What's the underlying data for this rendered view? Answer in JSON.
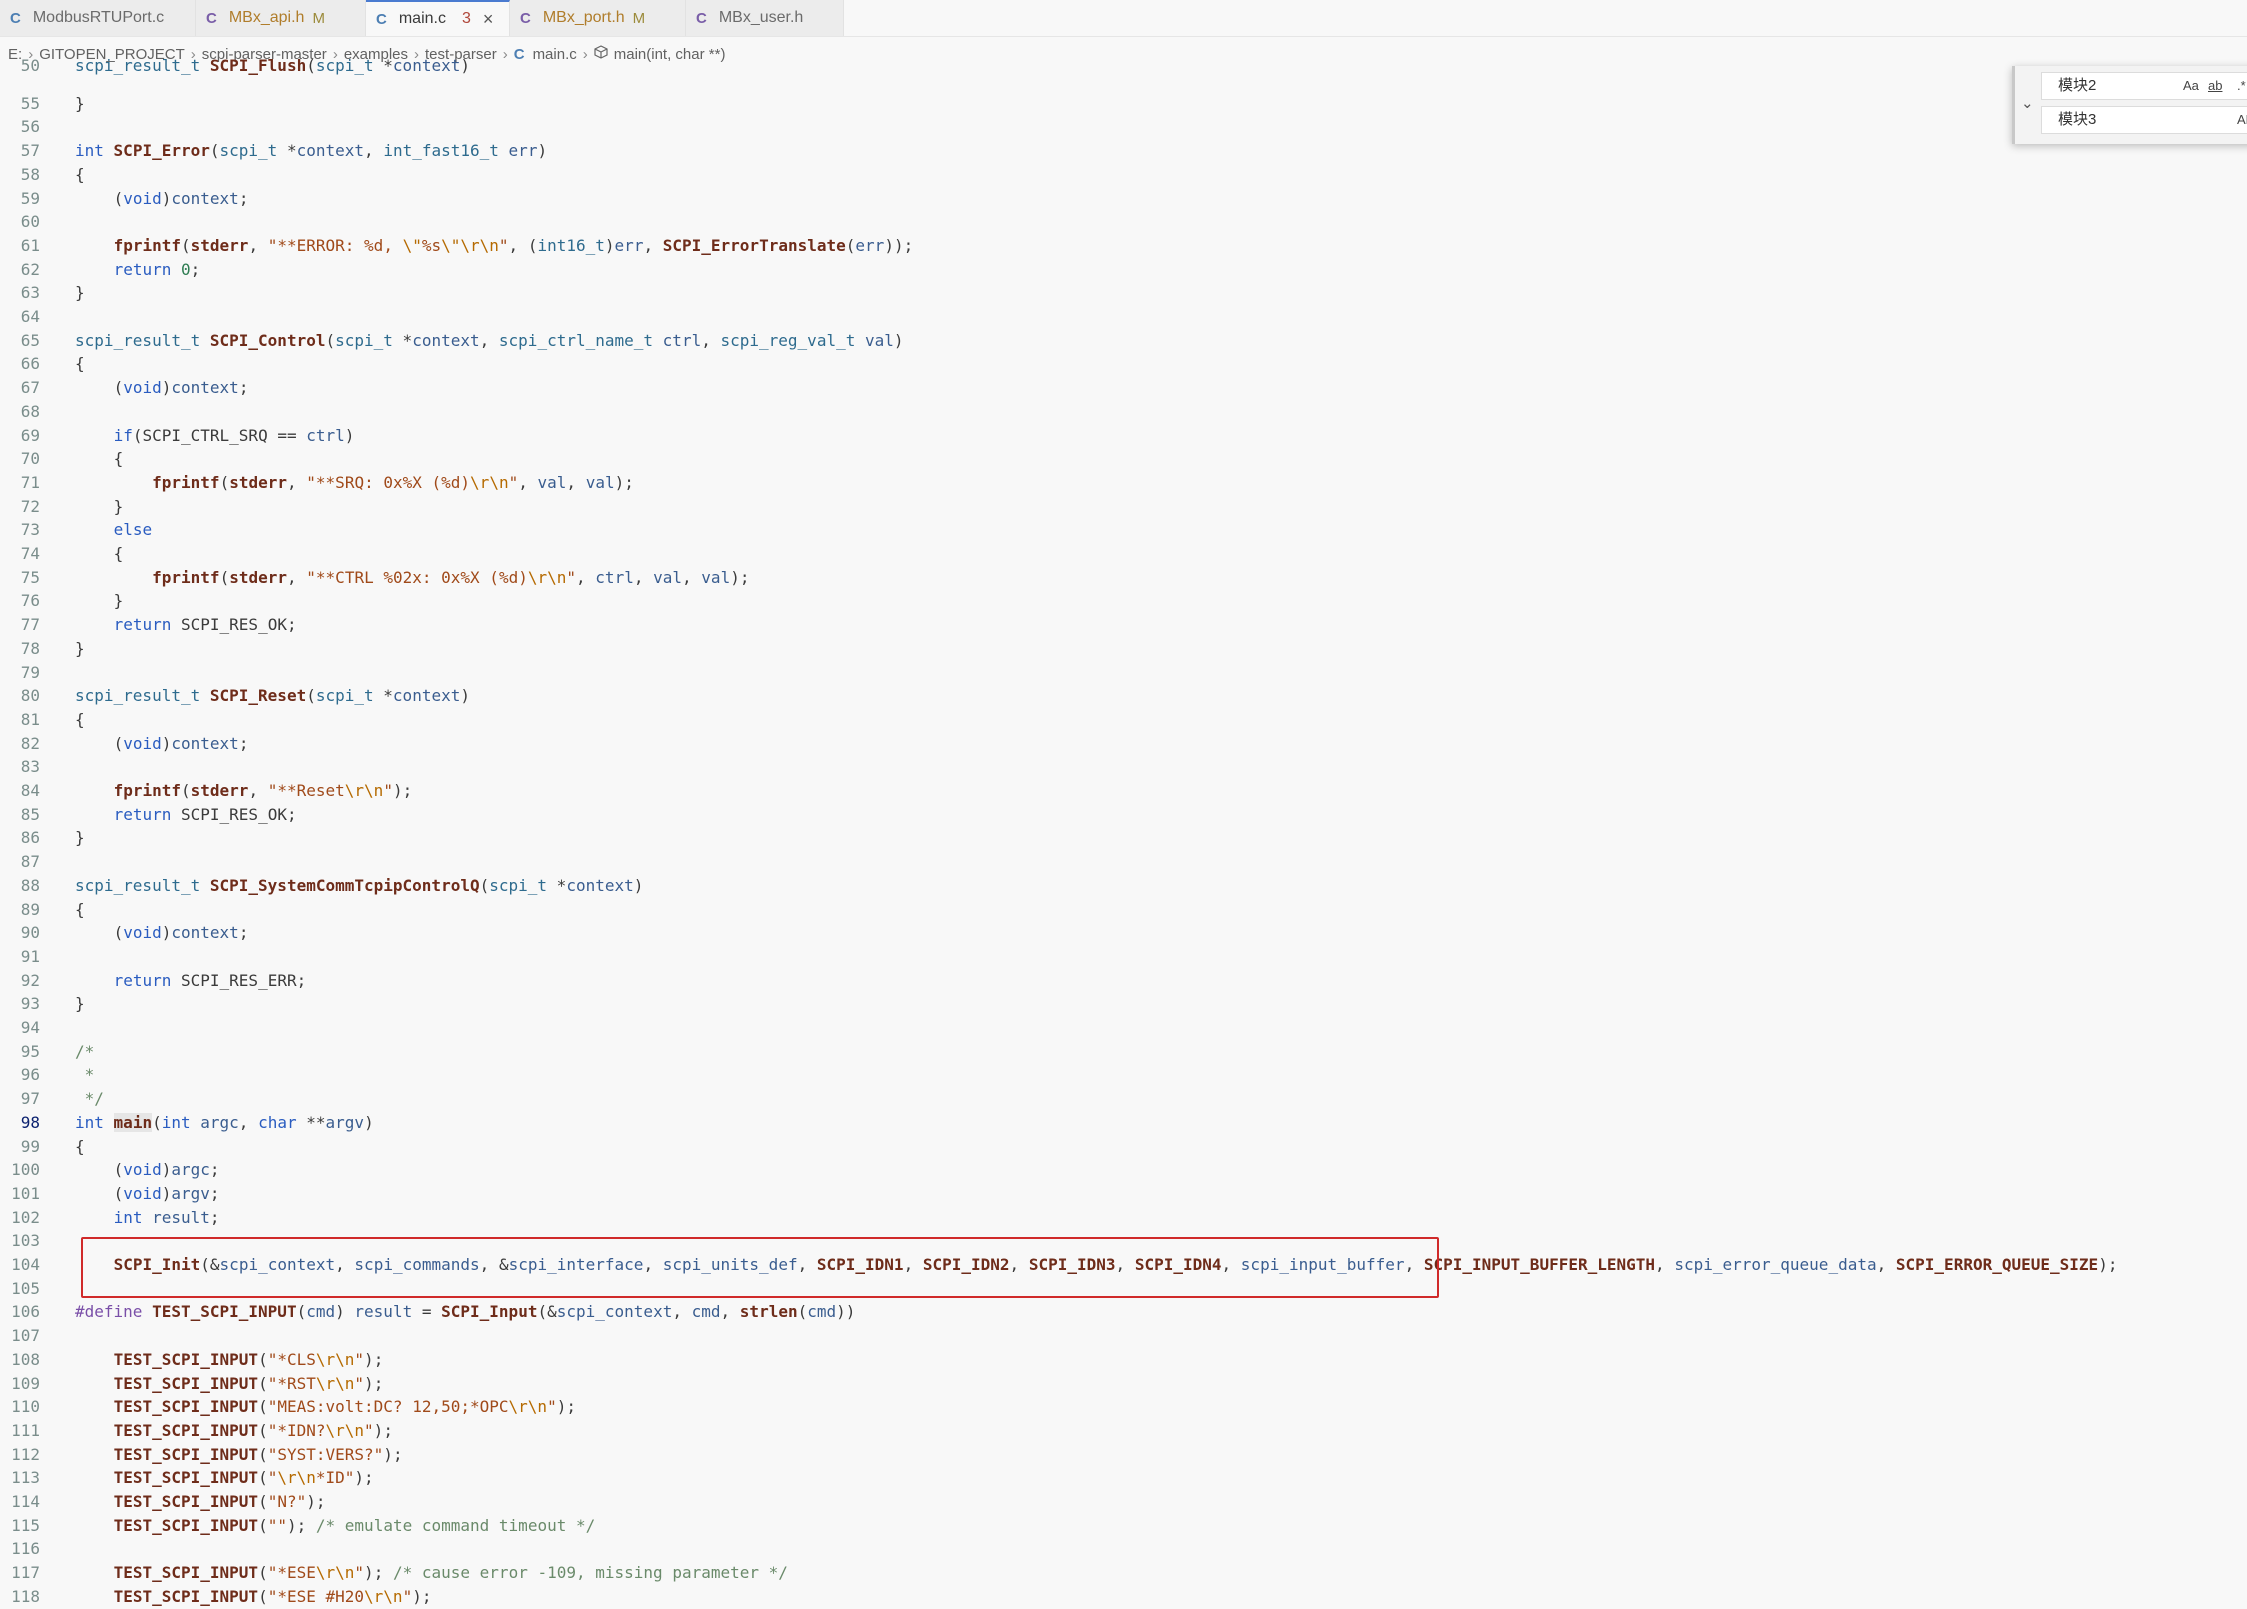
{
  "tabs": [
    {
      "label": "ModbusRTUPort.c",
      "icon": "C",
      "modified": "",
      "problems": ""
    },
    {
      "label": "MBx_api.h",
      "icon": "C",
      "modified": "M",
      "problems": ""
    },
    {
      "label": "main.c",
      "icon": "C",
      "modified": "",
      "problems": "3"
    },
    {
      "label": "MBx_port.h",
      "icon": "C",
      "modified": "M",
      "problems": ""
    },
    {
      "label": "MBx_user.h",
      "icon": "C",
      "modified": "",
      "problems": ""
    }
  ],
  "breadcrumb": [
    "E:",
    "GITOPEN_PROJECT",
    "scpi-parser-master",
    "examples",
    "test-parser",
    "main.c",
    "main(int, char **)"
  ],
  "find_widget": {
    "find_value": "模块2",
    "replace_value": "模块3",
    "match_case": "Aa",
    "whole_word": "ab",
    "regex": ".*",
    "replace_all": "AB"
  },
  "current_line": "98",
  "code_lines": [
    {
      "n": "50",
      "text": "scpi_result_t SCPI_Flush(scpi_t *context)"
    },
    {
      "n": "55",
      "text": "}"
    },
    {
      "n": "56",
      "text": ""
    },
    {
      "n": "57",
      "text": "int SCPI_Error(scpi_t *context, int_fast16_t err)"
    },
    {
      "n": "58",
      "text": "{"
    },
    {
      "n": "59",
      "text": "    (void)context;"
    },
    {
      "n": "60",
      "text": ""
    },
    {
      "n": "61",
      "text": "    fprintf(stderr, \"**ERROR: %d, \\\"%s\\\"\\r\\n\", (int16_t)err, SCPI_ErrorTranslate(err));"
    },
    {
      "n": "62",
      "text": "    return 0;"
    },
    {
      "n": "63",
      "text": "}"
    },
    {
      "n": "64",
      "text": ""
    },
    {
      "n": "65",
      "text": "scpi_result_t SCPI_Control(scpi_t *context, scpi_ctrl_name_t ctrl, scpi_reg_val_t val)"
    },
    {
      "n": "66",
      "text": "{"
    },
    {
      "n": "67",
      "text": "    (void)context;"
    },
    {
      "n": "68",
      "text": ""
    },
    {
      "n": "69",
      "text": "    if(SCPI_CTRL_SRQ == ctrl)"
    },
    {
      "n": "70",
      "text": "    {"
    },
    {
      "n": "71",
      "text": "        fprintf(stderr, \"**SRQ: 0x%X (%d)\\r\\n\", val, val);"
    },
    {
      "n": "72",
      "text": "    }"
    },
    {
      "n": "73",
      "text": "    else"
    },
    {
      "n": "74",
      "text": "    {"
    },
    {
      "n": "75",
      "text": "        fprintf(stderr, \"**CTRL %02x: 0x%X (%d)\\r\\n\", ctrl, val, val);"
    },
    {
      "n": "76",
      "text": "    }"
    },
    {
      "n": "77",
      "text": "    return SCPI_RES_OK;"
    },
    {
      "n": "78",
      "text": "}"
    },
    {
      "n": "79",
      "text": ""
    },
    {
      "n": "80",
      "text": "scpi_result_t SCPI_Reset(scpi_t *context)"
    },
    {
      "n": "81",
      "text": "{"
    },
    {
      "n": "82",
      "text": "    (void)context;"
    },
    {
      "n": "83",
      "text": ""
    },
    {
      "n": "84",
      "text": "    fprintf(stderr, \"**Reset\\r\\n\");"
    },
    {
      "n": "85",
      "text": "    return SCPI_RES_OK;"
    },
    {
      "n": "86",
      "text": "}"
    },
    {
      "n": "87",
      "text": ""
    },
    {
      "n": "88",
      "text": "scpi_result_t SCPI_SystemCommTcpipControlQ(scpi_t *context)"
    },
    {
      "n": "89",
      "text": "{"
    },
    {
      "n": "90",
      "text": "    (void)context;"
    },
    {
      "n": "91",
      "text": ""
    },
    {
      "n": "92",
      "text": "    return SCPI_RES_ERR;"
    },
    {
      "n": "93",
      "text": "}"
    },
    {
      "n": "94",
      "text": ""
    },
    {
      "n": "95",
      "text": "/*"
    },
    {
      "n": "96",
      "text": " *"
    },
    {
      "n": "97",
      "text": " */"
    },
    {
      "n": "98",
      "text": "int main(int argc, char **argv)"
    },
    {
      "n": "99",
      "text": "{"
    },
    {
      "n": "100",
      "text": "    (void)argc;"
    },
    {
      "n": "101",
      "text": "    (void)argv;"
    },
    {
      "n": "102",
      "text": "    int result;"
    },
    {
      "n": "103",
      "text": ""
    },
    {
      "n": "104",
      "text": "    SCPI_Init(&scpi_context, scpi_commands, &scpi_interface, scpi_units_def, SCPI_IDN1, SCPI_IDN2, SCPI_IDN3, SCPI_IDN4, scpi_input_buffer, SCPI_INPUT_BUFFER_LENGTH, scpi_error_queue_data, SCPI_ERROR_QUEUE_SIZE);"
    },
    {
      "n": "105",
      "text": ""
    },
    {
      "n": "106",
      "text": "#define TEST_SCPI_INPUT(cmd) result = SCPI_Input(&scpi_context, cmd, strlen(cmd))"
    },
    {
      "n": "107",
      "text": ""
    },
    {
      "n": "108",
      "text": "    TEST_SCPI_INPUT(\"*CLS\\r\\n\");"
    },
    {
      "n": "109",
      "text": "    TEST_SCPI_INPUT(\"*RST\\r\\n\");"
    },
    {
      "n": "110",
      "text": "    TEST_SCPI_INPUT(\"MEAS:volt:DC? 12,50;*OPC\\r\\n\");"
    },
    {
      "n": "111",
      "text": "    TEST_SCPI_INPUT(\"*IDN?\\r\\n\");"
    },
    {
      "n": "112",
      "text": "    TEST_SCPI_INPUT(\"SYST:VERS?\");"
    },
    {
      "n": "113",
      "text": "    TEST_SCPI_INPUT(\"\\r\\n*ID\");"
    },
    {
      "n": "114",
      "text": "    TEST_SCPI_INPUT(\"N?\");"
    },
    {
      "n": "115",
      "text": "    TEST_SCPI_INPUT(\"\"); /* emulate command timeout */"
    },
    {
      "n": "116",
      "text": ""
    },
    {
      "n": "117",
      "text": "    TEST_SCPI_INPUT(\"*ESE\\r\\n\"); /* cause error -109, missing parameter */"
    },
    {
      "n": "118",
      "text": "    TEST_SCPI_INPUT(\"*ESE #H20\\r\\n\");"
    }
  ]
}
